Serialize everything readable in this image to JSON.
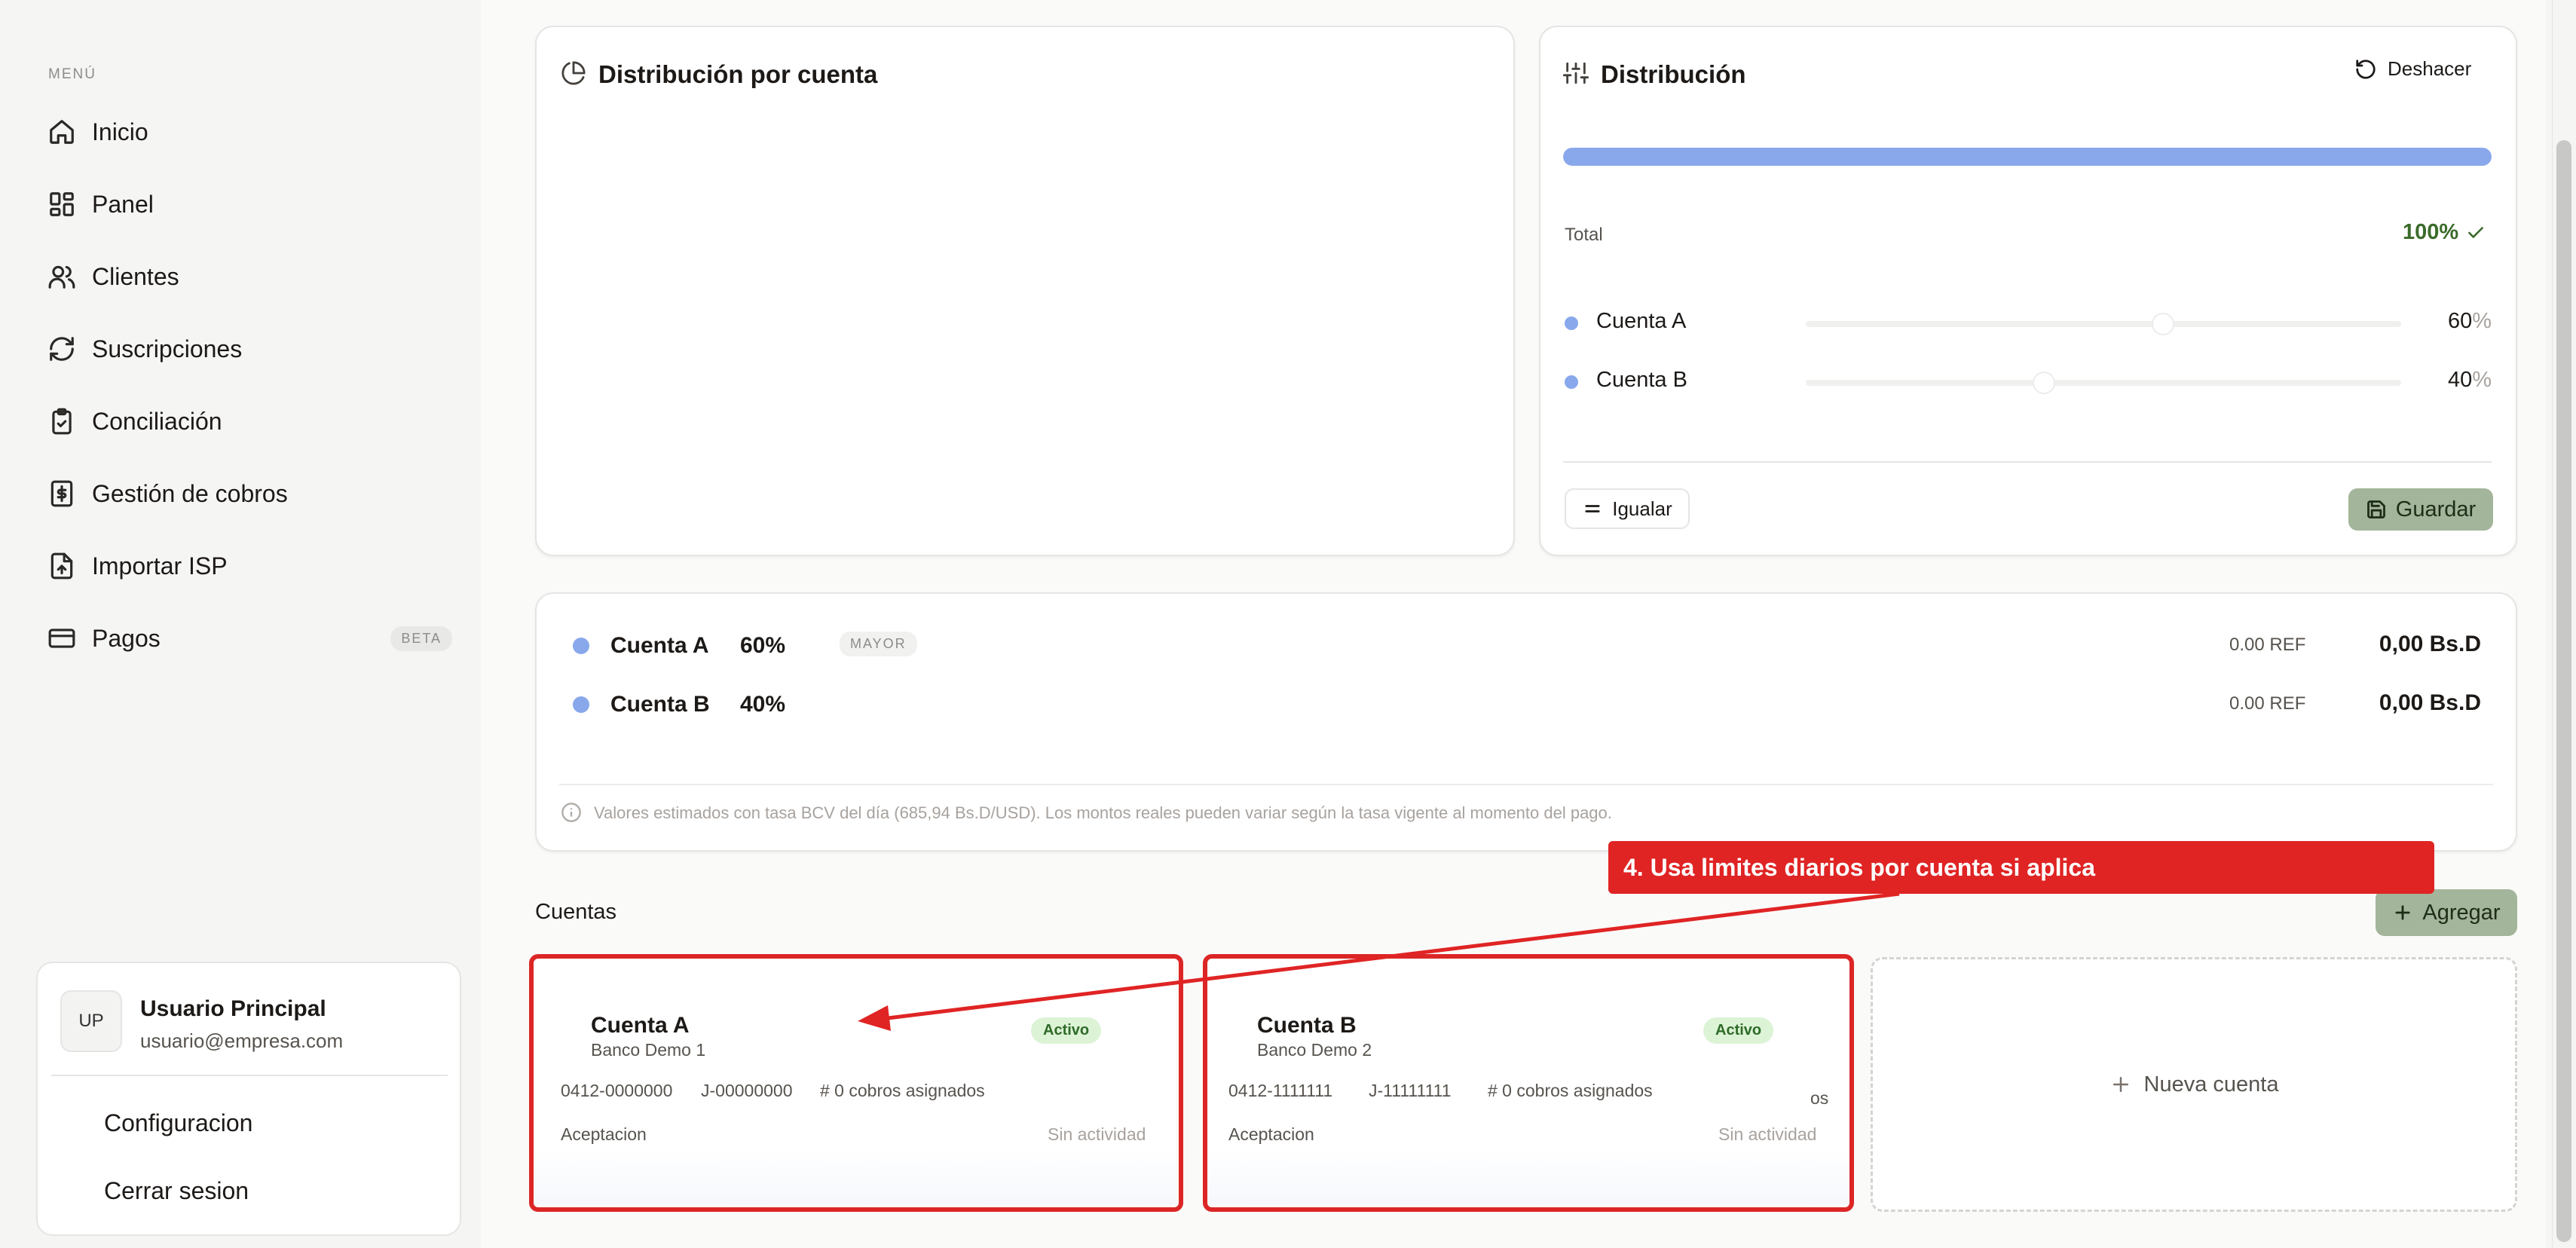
{
  "sidebar": {
    "menu_label": "MENÚ",
    "items": [
      {
        "label": "Inicio",
        "icon": "home-icon"
      },
      {
        "label": "Panel",
        "icon": "dashboard-icon"
      },
      {
        "label": "Clientes",
        "icon": "users-icon"
      },
      {
        "label": "Suscripciones",
        "icon": "refresh-icon"
      },
      {
        "label": "Conciliación",
        "icon": "clipboard-check-icon"
      },
      {
        "label": "Gestión de cobros",
        "icon": "dollar-file-icon"
      },
      {
        "label": "Importar ISP",
        "icon": "file-upload-icon"
      },
      {
        "label": "Pagos",
        "icon": "credit-card-icon",
        "badge": "BETA"
      }
    ],
    "user": {
      "initials": "UP",
      "name": "Usuario Principal",
      "email": "usuario@empresa.com",
      "menu": [
        "Configuracion",
        "Cerrar sesion"
      ]
    }
  },
  "chart_panel": {
    "title": "Distribución por cuenta"
  },
  "distribution": {
    "title": "Distribución",
    "undo_label": "Deshacer",
    "progress_percent": 100,
    "total_label": "Total",
    "total_value": "100%",
    "accounts": [
      {
        "name": "Cuenta A",
        "value": "60",
        "fraction": 0.6,
        "unit": "%"
      },
      {
        "name": "Cuenta B",
        "value": "40",
        "fraction": 0.4,
        "unit": "%"
      }
    ],
    "equalize_label": "Igualar",
    "save_label": "Guardar"
  },
  "summary": {
    "rows": [
      {
        "name": "Cuenta A",
        "percent": "60%",
        "badge": "MAYOR",
        "ref": "0.00 REF",
        "amount": "0,00 Bs.D"
      },
      {
        "name": "Cuenta B",
        "percent": "40%",
        "badge": "",
        "ref": "0.00 REF",
        "amount": "0,00 Bs.D"
      }
    ],
    "note": "Valores estimados con tasa BCV del día (685,94 Bs.D/USD). Los montos reales pueden variar según la tasa vigente al momento del pago."
  },
  "accounts_section": {
    "title": "Cuentas",
    "add_label": "Agregar",
    "cards": [
      {
        "name": "Cuenta A",
        "bank": "Banco Demo 1",
        "status": "Activo",
        "phone": "0412-0000000",
        "rif": "J-00000000",
        "cobros": "# 0 cobros asignados",
        "type": "Aceptacion",
        "activity": "Sin actividad",
        "overflow": ""
      },
      {
        "name": "Cuenta B",
        "bank": "Banco Demo 2",
        "status": "Activo",
        "phone": "0412-1111111",
        "rif": "J-11111111",
        "cobros": "# 0 cobros asignados",
        "type": "Aceptacion",
        "activity": "Sin actividad",
        "overflow": "os"
      }
    ],
    "new_account_label": "Nueva cuenta"
  },
  "annotation": {
    "text": "4. Usa limites diarios por cuenta si aplica"
  },
  "colors": {
    "account_blue": "#89a8ec",
    "save_green": "#a3b59a",
    "active_badge": "#dcf3d6",
    "annotation_red": "#e02424",
    "total_ok": "#3a6b2a"
  }
}
